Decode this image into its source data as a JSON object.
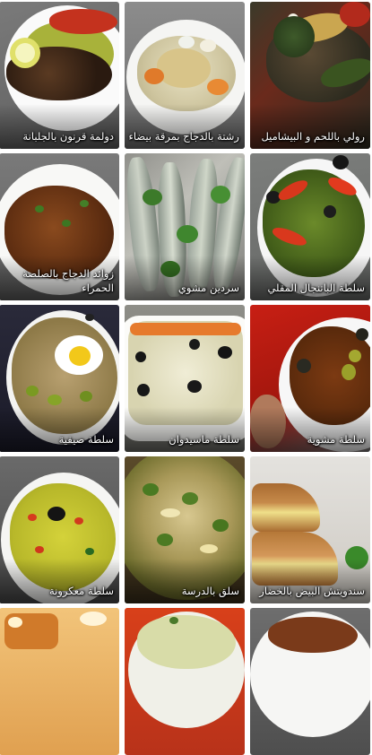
{
  "recipes": [
    {
      "title": "رولي باللحم و البيشاميل"
    },
    {
      "title": "رشتة بالدجاج بمرقة بيضاء"
    },
    {
      "title": "دولمة قرنون بالجلبانة"
    },
    {
      "title": "سلطة الباتنجال المقلي"
    },
    {
      "title": "سردين مشوي"
    },
    {
      "title": "زوائد الدجاج بالصلصة الحمراء"
    },
    {
      "title": "سلطة مشوية"
    },
    {
      "title": "سلطة ماسيدوان"
    },
    {
      "title": "سلطة صيفية"
    },
    {
      "title": "سندويتش البيض بالخضار"
    },
    {
      "title": "سلق بالدرسة"
    },
    {
      "title": "سلطة معكرونة"
    },
    {
      "title": ""
    },
    {
      "title": ""
    },
    {
      "title": ""
    }
  ]
}
